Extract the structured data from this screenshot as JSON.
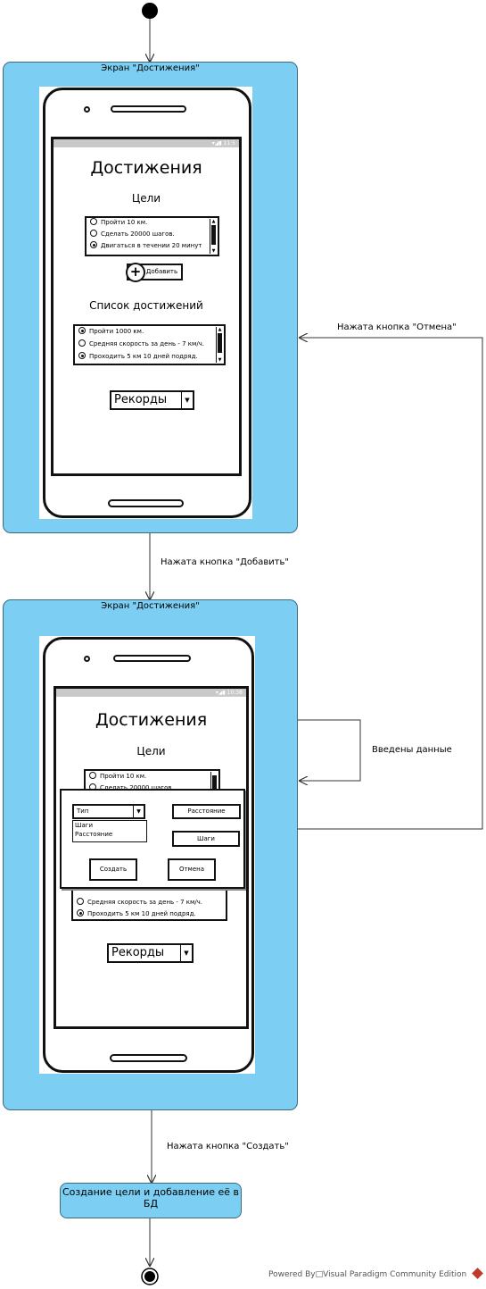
{
  "diagram": {
    "state1": {
      "title": "Экран \"Достижения\"",
      "screen": {
        "status": "▾◢▮ 11:5",
        "heading": "Достижения",
        "goals_label": "Цели",
        "goals": [
          {
            "text": "Пройти 10 км.",
            "selected": false
          },
          {
            "text": "Сделать 20000 шагов.",
            "selected": false
          },
          {
            "text": "Двигаться в течении 20 минут",
            "selected": true
          }
        ],
        "add_button": "Добавить",
        "achievements_label": "Список достижений",
        "achievements": [
          {
            "text": "Пройти 1000 км.",
            "selected": true
          },
          {
            "text": "Средняя скорость за день - 7 км/ч.",
            "selected": false
          },
          {
            "text": "Проходить 5 км 10 дней подряд.",
            "selected": true
          }
        ],
        "records_dropdown": "Рекорды"
      }
    },
    "state2": {
      "title": "Экран \"Достижения\"",
      "screen": {
        "status": "▾◢▮ 10:38",
        "heading": "Достижения",
        "goals_label": "Цели",
        "goals": [
          {
            "text": "Пройти 10 км.",
            "selected": false
          },
          {
            "text": "Сделать 20000 шагов.",
            "selected": false
          }
        ],
        "achievements": [
          {
            "text": "Средняя скорость за день - 7 км/ч.",
            "selected": false
          },
          {
            "text": "Проходить 5 км 10 дней подряд.",
            "selected": true
          }
        ],
        "records_dropdown": "Рекорды",
        "dialog": {
          "type_select": "Тип",
          "type_options": [
            "Шаги",
            "Расстояние"
          ],
          "distance_button": "Расстояние",
          "steps_button": "Шаги",
          "create_button": "Создать",
          "cancel_button": "Отмена"
        }
      }
    },
    "transitions": {
      "add_pressed": "Нажата кнопка \"Добавить\"",
      "cancel_pressed": "Нажата кнопка \"Отмена\"",
      "data_entered": "Введены данные",
      "create_pressed": "Нажата кнопка \"Создать\""
    },
    "action": "Создание цели и добавление её в БД",
    "footer": "Powered By□Visual Paradigm Community Edition"
  }
}
